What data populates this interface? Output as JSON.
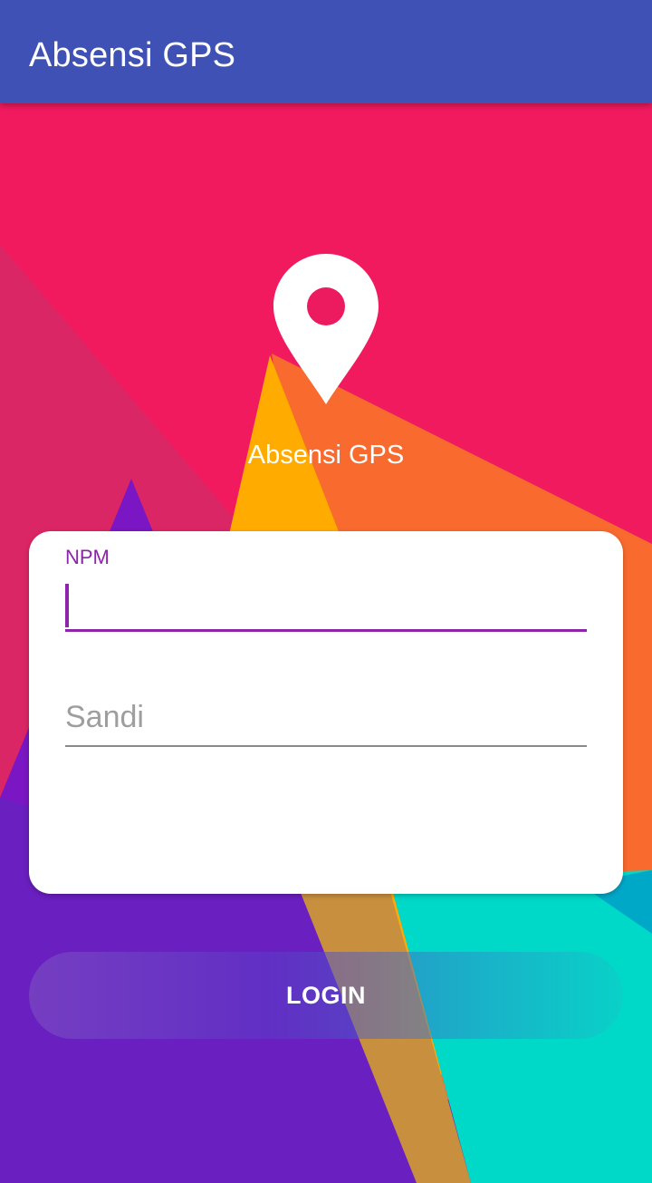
{
  "app_bar": {
    "title": "Absensi GPS"
  },
  "logo": {
    "icon": "location-pin-icon",
    "title": "Absensi GPS"
  },
  "form": {
    "npm": {
      "label": "NPM",
      "value": ""
    },
    "sandi": {
      "placeholder": "Sandi",
      "value": ""
    }
  },
  "login_button": {
    "label": "LOGIN"
  },
  "colors": {
    "app_bar": "#3f51b5",
    "accent": "#8e24aa",
    "background_pink": "#f21a5e",
    "background_orange": "#f96a2e",
    "background_yellow": "#ffab00",
    "background_purple": "#6a1fc0",
    "background_teal": "#00d8c8"
  }
}
